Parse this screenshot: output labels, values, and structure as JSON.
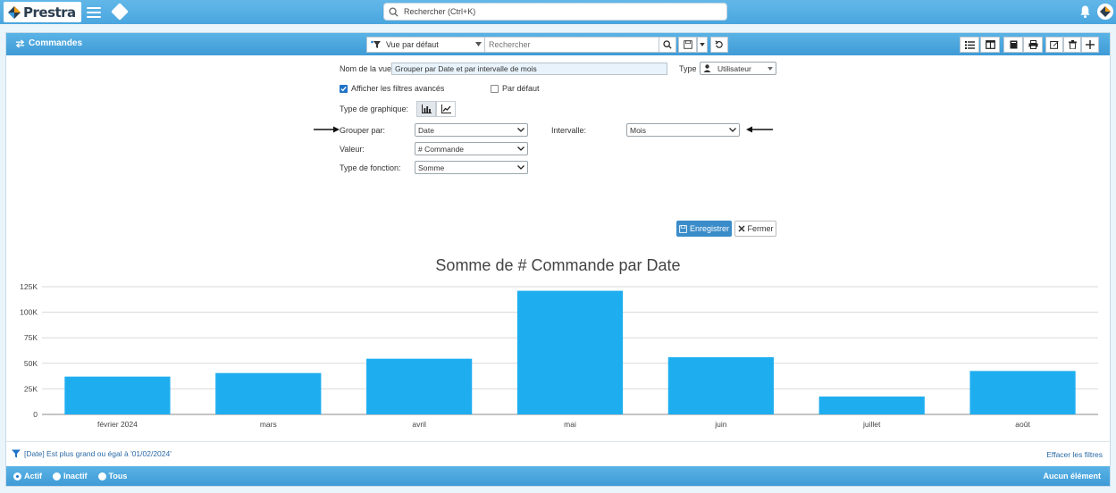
{
  "app": {
    "logo_text": "Prestra",
    "global_search_placeholder": "Rechercher (Ctrl+K)"
  },
  "panel": {
    "title": "Commandes",
    "view_select_value": "Vue par défaut",
    "search_placeholder": "Rechercher"
  },
  "form": {
    "view_name_label": "Nom de la vue :",
    "view_name_value": "Grouper par Date et par intervalle de mois",
    "type_label": "Type :",
    "type_value": "Utilisateur",
    "show_advanced_label": "Afficher les filtres avancés",
    "show_advanced_checked": true,
    "default_label": "Par défaut",
    "default_checked": false,
    "chart_type_label": "Type de graphique:",
    "group_by_label": "Grouper par:",
    "group_by_value": "Date",
    "interval_label": "Intervalle:",
    "interval_value": "Mois",
    "value_label": "Valeur:",
    "value_value": "# Commande",
    "function_label": "Type de fonction:",
    "function_value": "Somme",
    "save_label": "Enregistrer",
    "close_label": "Fermer"
  },
  "chart_data": {
    "type": "bar",
    "title": "Somme de # Commande par Date",
    "categories": [
      "février 2024",
      "mars",
      "avril",
      "mai",
      "juin",
      "juillet",
      "août"
    ],
    "values": [
      37000,
      40500,
      54500,
      121000,
      56000,
      17500,
      42500
    ],
    "ylim": [
      0,
      125000
    ],
    "yticks": [
      0,
      25000,
      50000,
      75000,
      100000,
      125000
    ],
    "ytick_labels": [
      "0",
      "25K",
      "50K",
      "75K",
      "100K",
      "125K"
    ],
    "bar_color": "#1eaef0",
    "grid": true
  },
  "footer": {
    "filter_text": "[Date] Est plus grand ou égal à '01/02/2024'",
    "clear_filters": "Effacer les filtres",
    "radio_active": "Actif",
    "radio_inactive": "Inactif",
    "radio_all": "Tous",
    "no_items": "Aucun élément"
  },
  "colors": {
    "topbar": "#4aa6df",
    "accent": "#3a8cc9"
  }
}
